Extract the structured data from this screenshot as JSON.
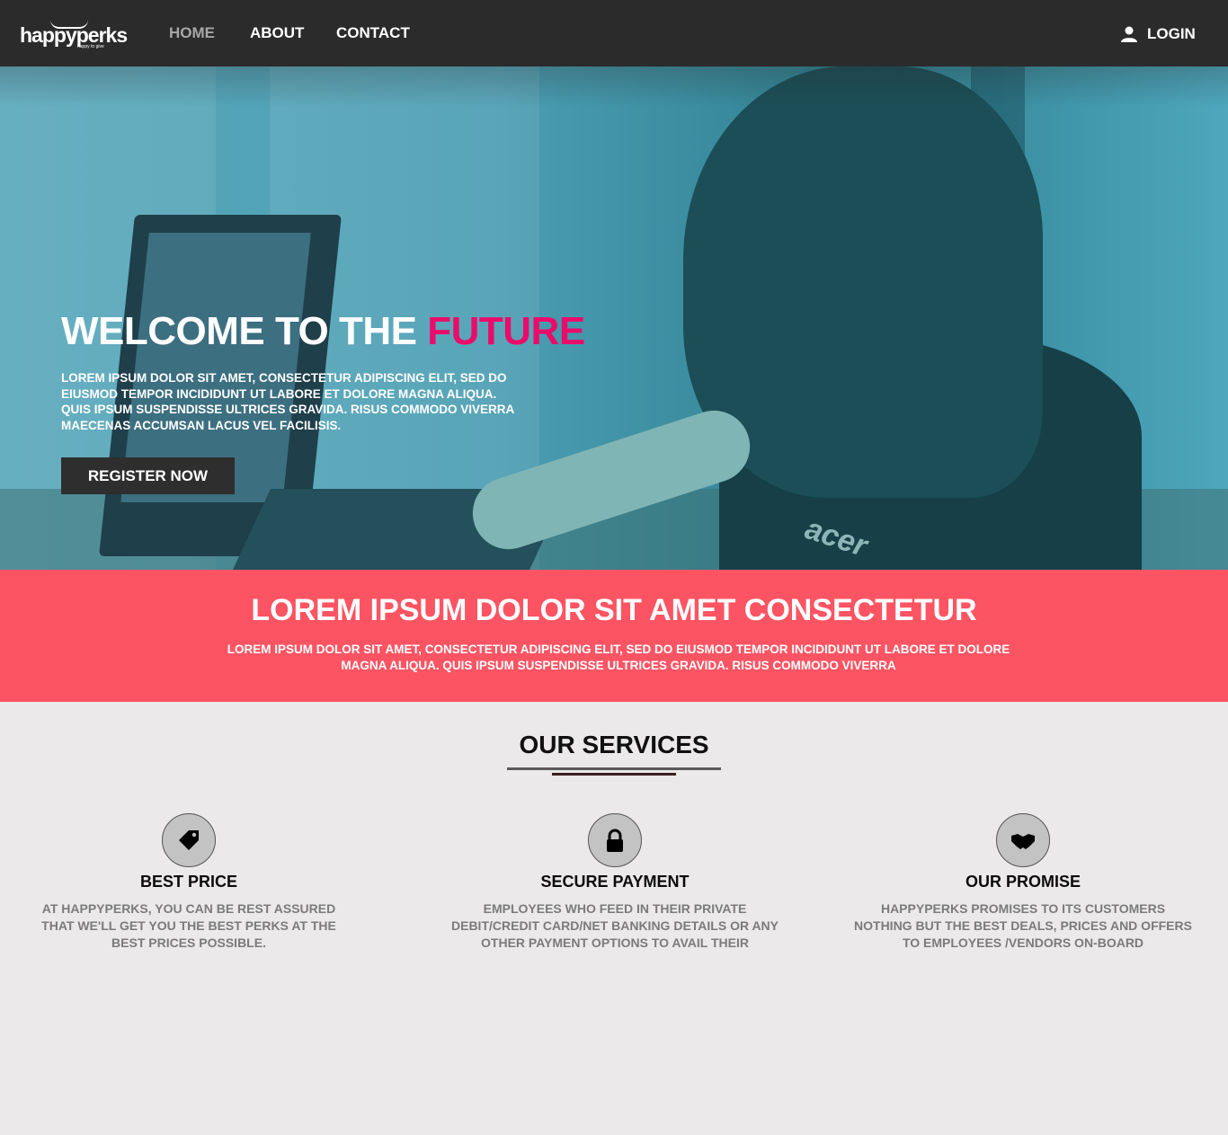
{
  "header": {
    "logo": "happyperks",
    "logo_tagline": "happy to give",
    "nav": [
      {
        "label": "HOME",
        "active": true
      },
      {
        "label": "ABOUT",
        "active": false
      },
      {
        "label": "CONTACT",
        "active": false
      }
    ],
    "login_label": "LOGIN"
  },
  "hero": {
    "title_main": "WELCOME TO THE ",
    "title_accent": "FUTURE",
    "text": "LOREM IPSUM DOLOR SIT AMET, CONSECTETUR ADIPISCING ELIT, SED DO EIUSMOD TEMPOR INCIDIDUNT UT LABORE ET DOLORE MAGNA ALIQUA. QUIS IPSUM SUSPENDISSE ULTRICES GRAVIDA. RISUS COMMODO VIVERRA MAECENAS ACCUMSAN LACUS VEL FACILISIS.",
    "register_label": "REGISTER NOW",
    "laptop_brand": "acer"
  },
  "banner": {
    "title": "LOREM IPSUM DOLOR SIT AMET CONSECTETUR",
    "text": "LOREM IPSUM DOLOR SIT AMET, CONSECTETUR ADIPISCING ELIT, SED DO EIUSMOD TEMPOR INCIDIDUNT UT LABORE ET DOLORE MAGNA ALIQUA. QUIS IPSUM SUSPENDISSE ULTRICES GRAVIDA. RISUS COMMODO VIVERRA"
  },
  "services": {
    "title": "OUR SERVICES",
    "items": [
      {
        "icon": "price-tag-icon",
        "title": "BEST PRICE",
        "text": "AT HAPPYPERKS, YOU CAN BE REST ASSURED THAT WE'LL GET YOU THE BEST PERKS AT THE BEST PRICES POSSIBLE."
      },
      {
        "icon": "lock-icon",
        "title": "SECURE PAYMENT",
        "text": "EMPLOYEES WHO FEED IN THEIR PRIVATE DEBIT/CREDIT CARD/NET BANKING DETAILS OR ANY OTHER PAYMENT OPTIONS TO AVAIL THEIR"
      },
      {
        "icon": "handshake-icon",
        "title": "OUR PROMISE",
        "text": "HAPPYPERKS PROMISES TO ITS CUSTOMERS NOTHING BUT THE BEST DEALS, PRICES AND OFFERS TO EMPLOYEES /VENDORS ON-BOARD"
      }
    ]
  },
  "colors": {
    "header_bg": "#2b2b2b",
    "accent_pink": "#ea0b6a",
    "banner_bg": "#fd5463",
    "page_bg": "#ebe9ea"
  }
}
